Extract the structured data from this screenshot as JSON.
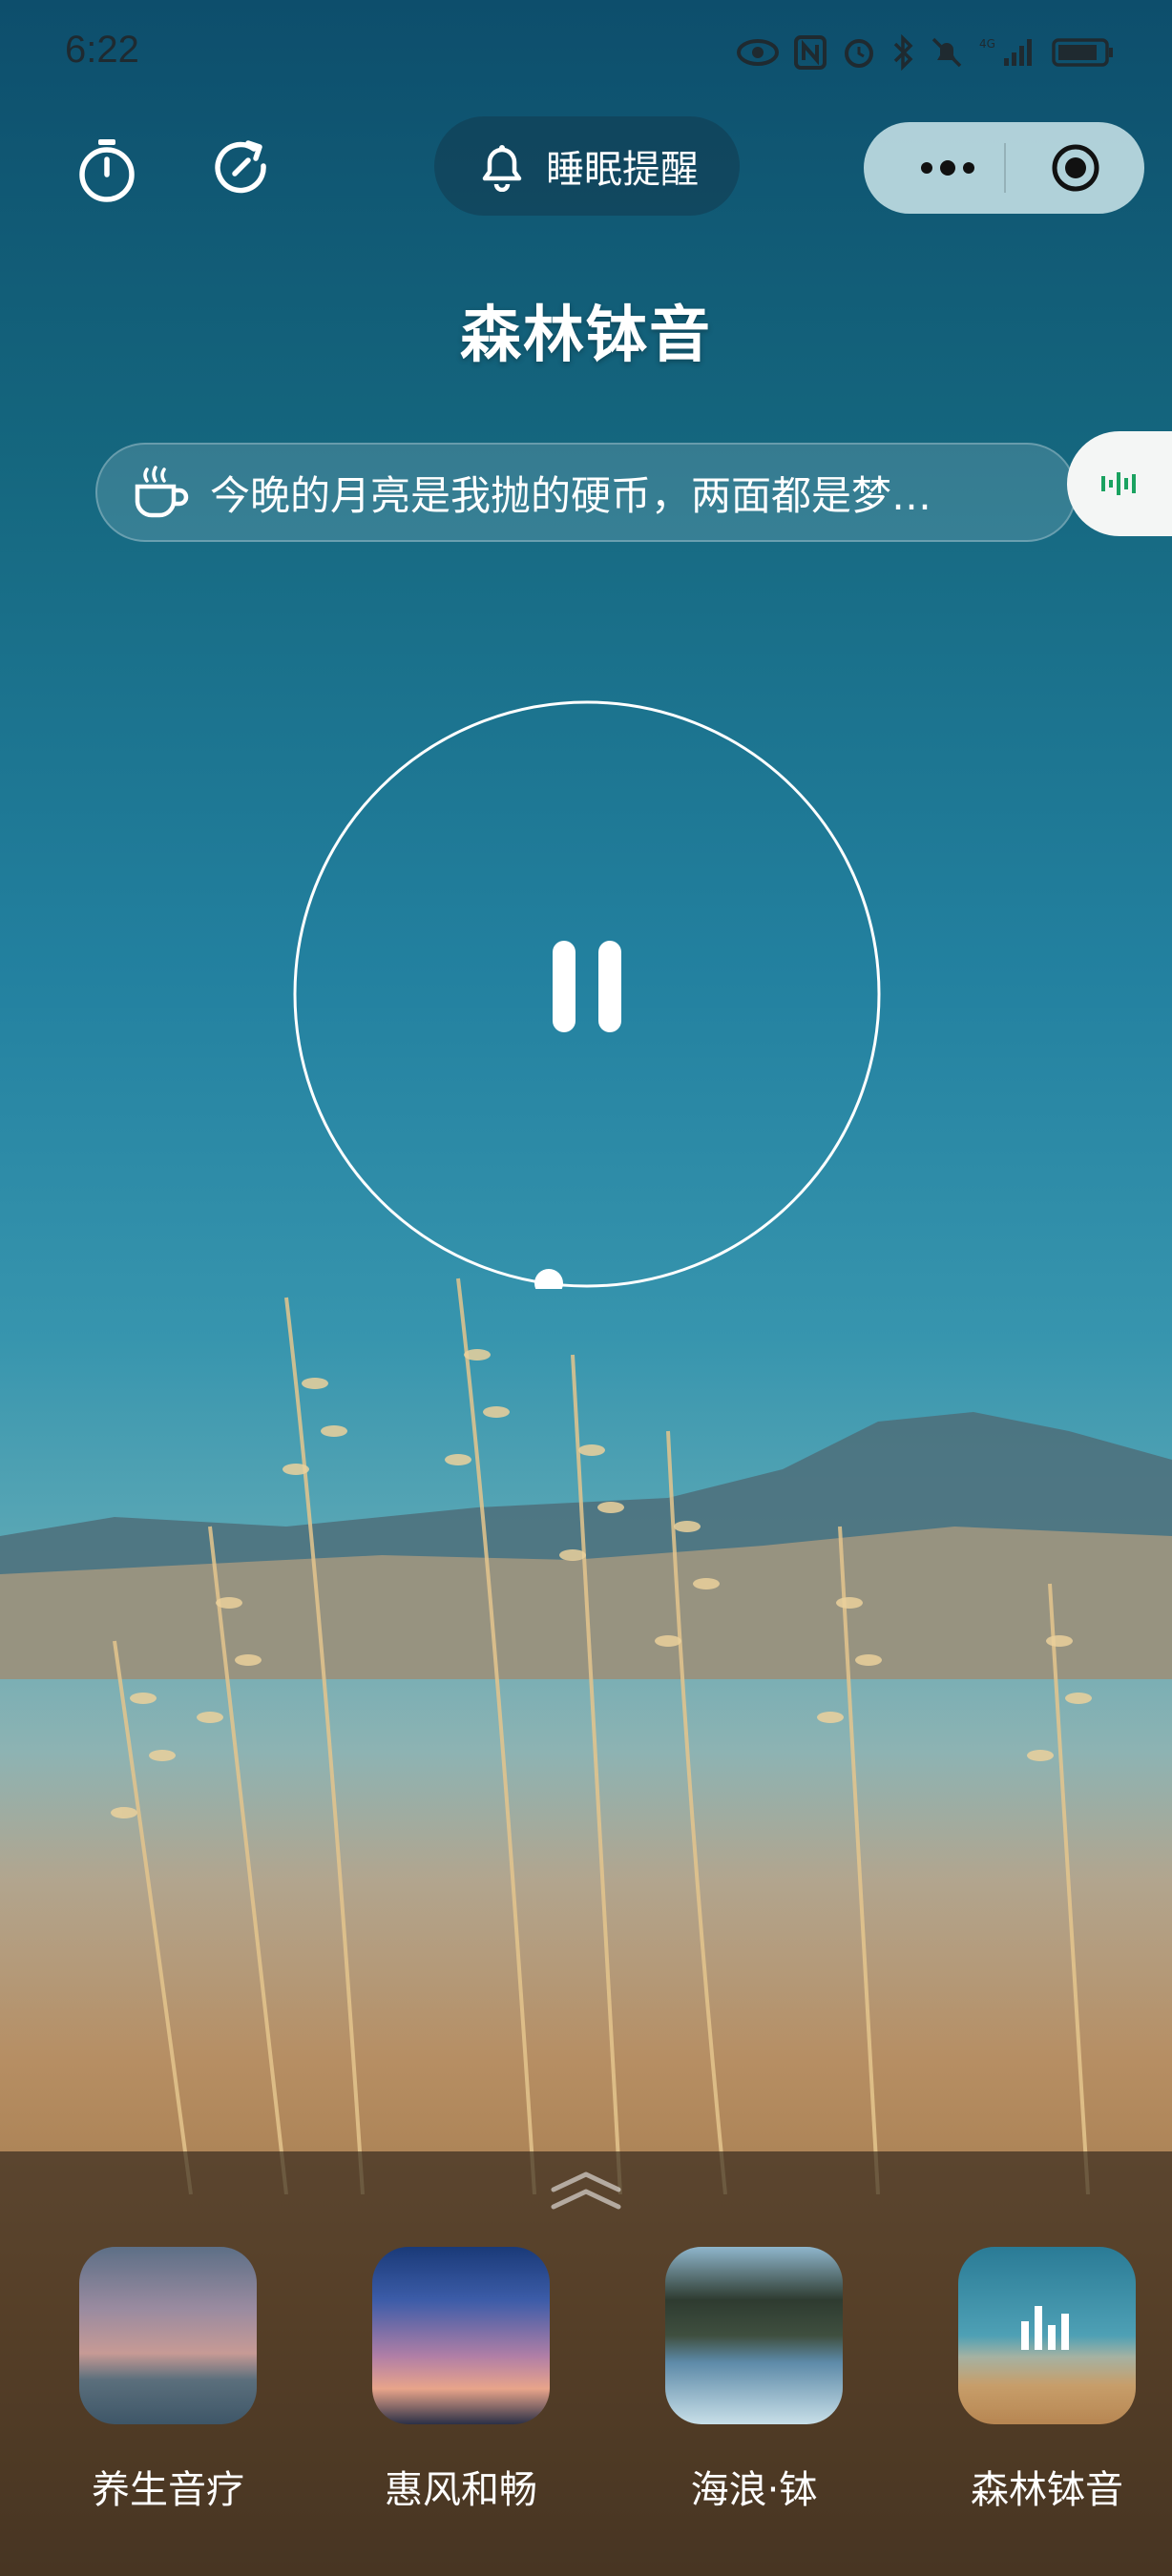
{
  "status_bar": {
    "time": "6:22",
    "network": "4G"
  },
  "toolbar": {
    "timer_icon": "timer-icon",
    "refresh_icon": "refresh-icon",
    "sleep_reminder_label": "睡眠提醒",
    "sleep_reminder_icon": "bell-icon",
    "more_icon": "more-icon",
    "close_icon": "target-icon"
  },
  "title": "森林钵音",
  "quote": {
    "icon": "coffee-cup-icon",
    "text": "今晚的月亮是我抛的硬币，两面都是梦…"
  },
  "player": {
    "state": "playing",
    "control_icon": "pause-icon"
  },
  "scenes": [
    {
      "label": "养生音疗"
    },
    {
      "label": "惠风和畅"
    },
    {
      "label": "海浪·钵"
    },
    {
      "label": "森林钵音",
      "active": true
    }
  ],
  "colors": {
    "accent": "#1aa260",
    "sky_top": "#0d4e6c",
    "sky_mid": "#3795ae",
    "field": "#b68e63"
  }
}
